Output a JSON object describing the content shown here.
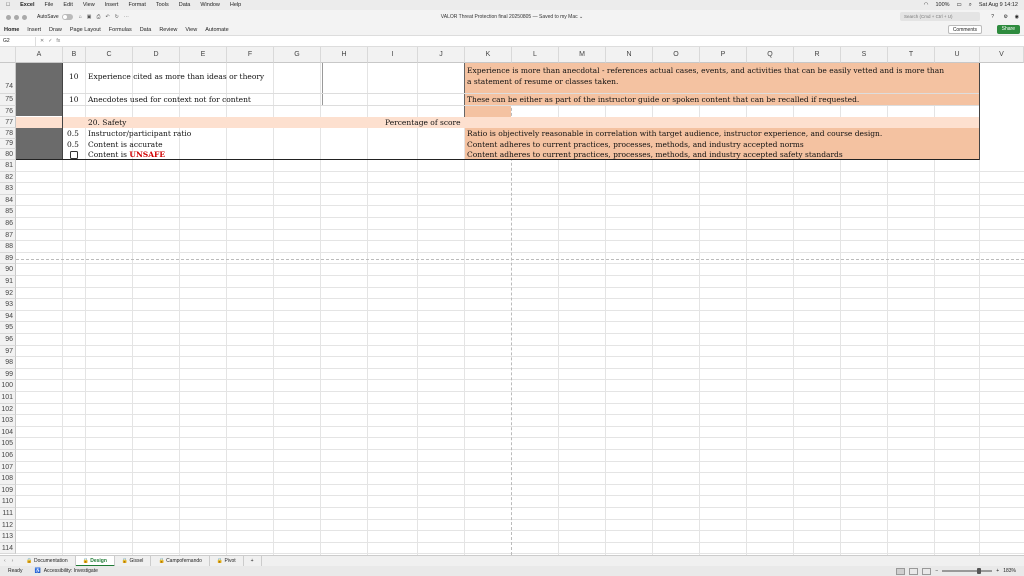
{
  "menubar": {
    "app": "Excel",
    "items": [
      "File",
      "Edit",
      "View",
      "Insert",
      "Format",
      "Tools",
      "Data",
      "Window",
      "Help"
    ],
    "battery": "100%",
    "clock": "Sat Aug 9  14:12"
  },
  "titlebar": {
    "autosave_label": "AutoSave",
    "document_title": "VALOR Threat Protection final 20250805 — Saved to my Mac ⌄",
    "search_placeholder": "Search (Cmd + Ctrl + U)"
  },
  "ribbon": {
    "tabs": [
      "Home",
      "Insert",
      "Draw",
      "Page Layout",
      "Formulas",
      "Data",
      "Review",
      "View",
      "Automate"
    ],
    "comments_label": "Comments",
    "share_label": "Share"
  },
  "formula_bar": {
    "name_box": "G2",
    "fx": "fx"
  },
  "columns": [
    "A",
    "B",
    "C",
    "D",
    "E",
    "F",
    "G",
    "H",
    "I",
    "J",
    "K",
    "L",
    "M",
    "N",
    "O",
    "P",
    "Q",
    "R",
    "S",
    "T",
    "U",
    "V"
  ],
  "rows": {
    "r74": {
      "num": "74",
      "score": "10",
      "text": "Experience cited as more than ideas or theory",
      "note1": "Experience is more than anecdotal - references actual cases, events, and activities that can be easily vetted and is more than",
      "note2": "a statement of resume or classes taken."
    },
    "r75": {
      "num": "75",
      "score": "10",
      "text": "Anecdotes used for context not for content",
      "note": "These can be either as part of the instructor guide or spoken content that can be recalled if requested."
    },
    "r76": {
      "num": "76"
    },
    "r77": {
      "num": "77",
      "section": "20. Safety",
      "pct_label": "Percentage of score"
    },
    "r78": {
      "num": "78",
      "score": "0.5",
      "text": "Instructor/participant ratio",
      "note": "Ratio is objectively reasonable in correlation with target audience, instructor experience, and course design."
    },
    "r79": {
      "num": "79",
      "score": "0.5",
      "text": "Content is accurate",
      "note": "Content adheres to current practices, processes, methods, and industry accepted norms"
    },
    "r80": {
      "num": "80",
      "text_prefix": "Content is ",
      "text_red": "UNSAFE",
      "note": "Content adheres to current practices, processes, methods, and industry accepted safety standards"
    }
  },
  "empty_rows": [
    "81",
    "82",
    "83",
    "84",
    "85",
    "86",
    "87",
    "88",
    "89",
    "90",
    "91",
    "92",
    "93",
    "94",
    "95",
    "96",
    "97",
    "98",
    "99",
    "100",
    "101",
    "102",
    "103",
    "104",
    "105",
    "106",
    "107",
    "108",
    "109",
    "110",
    "111",
    "112",
    "113",
    "114"
  ],
  "sheets": [
    "Documentation",
    "Design",
    "Gissel",
    "Campofernando",
    "Pivot"
  ],
  "active_sheet": "Design",
  "status": {
    "ready": "Ready",
    "accessibility": "Accessibility: Investigate",
    "zoom": "183%"
  },
  "colors": {
    "peach": "#f4c2a1",
    "light_peach": "#fde0cf",
    "dark_gray": "#6b6b6b",
    "unsafe_red": "#d10000",
    "share_green": "#2e8b3e"
  }
}
